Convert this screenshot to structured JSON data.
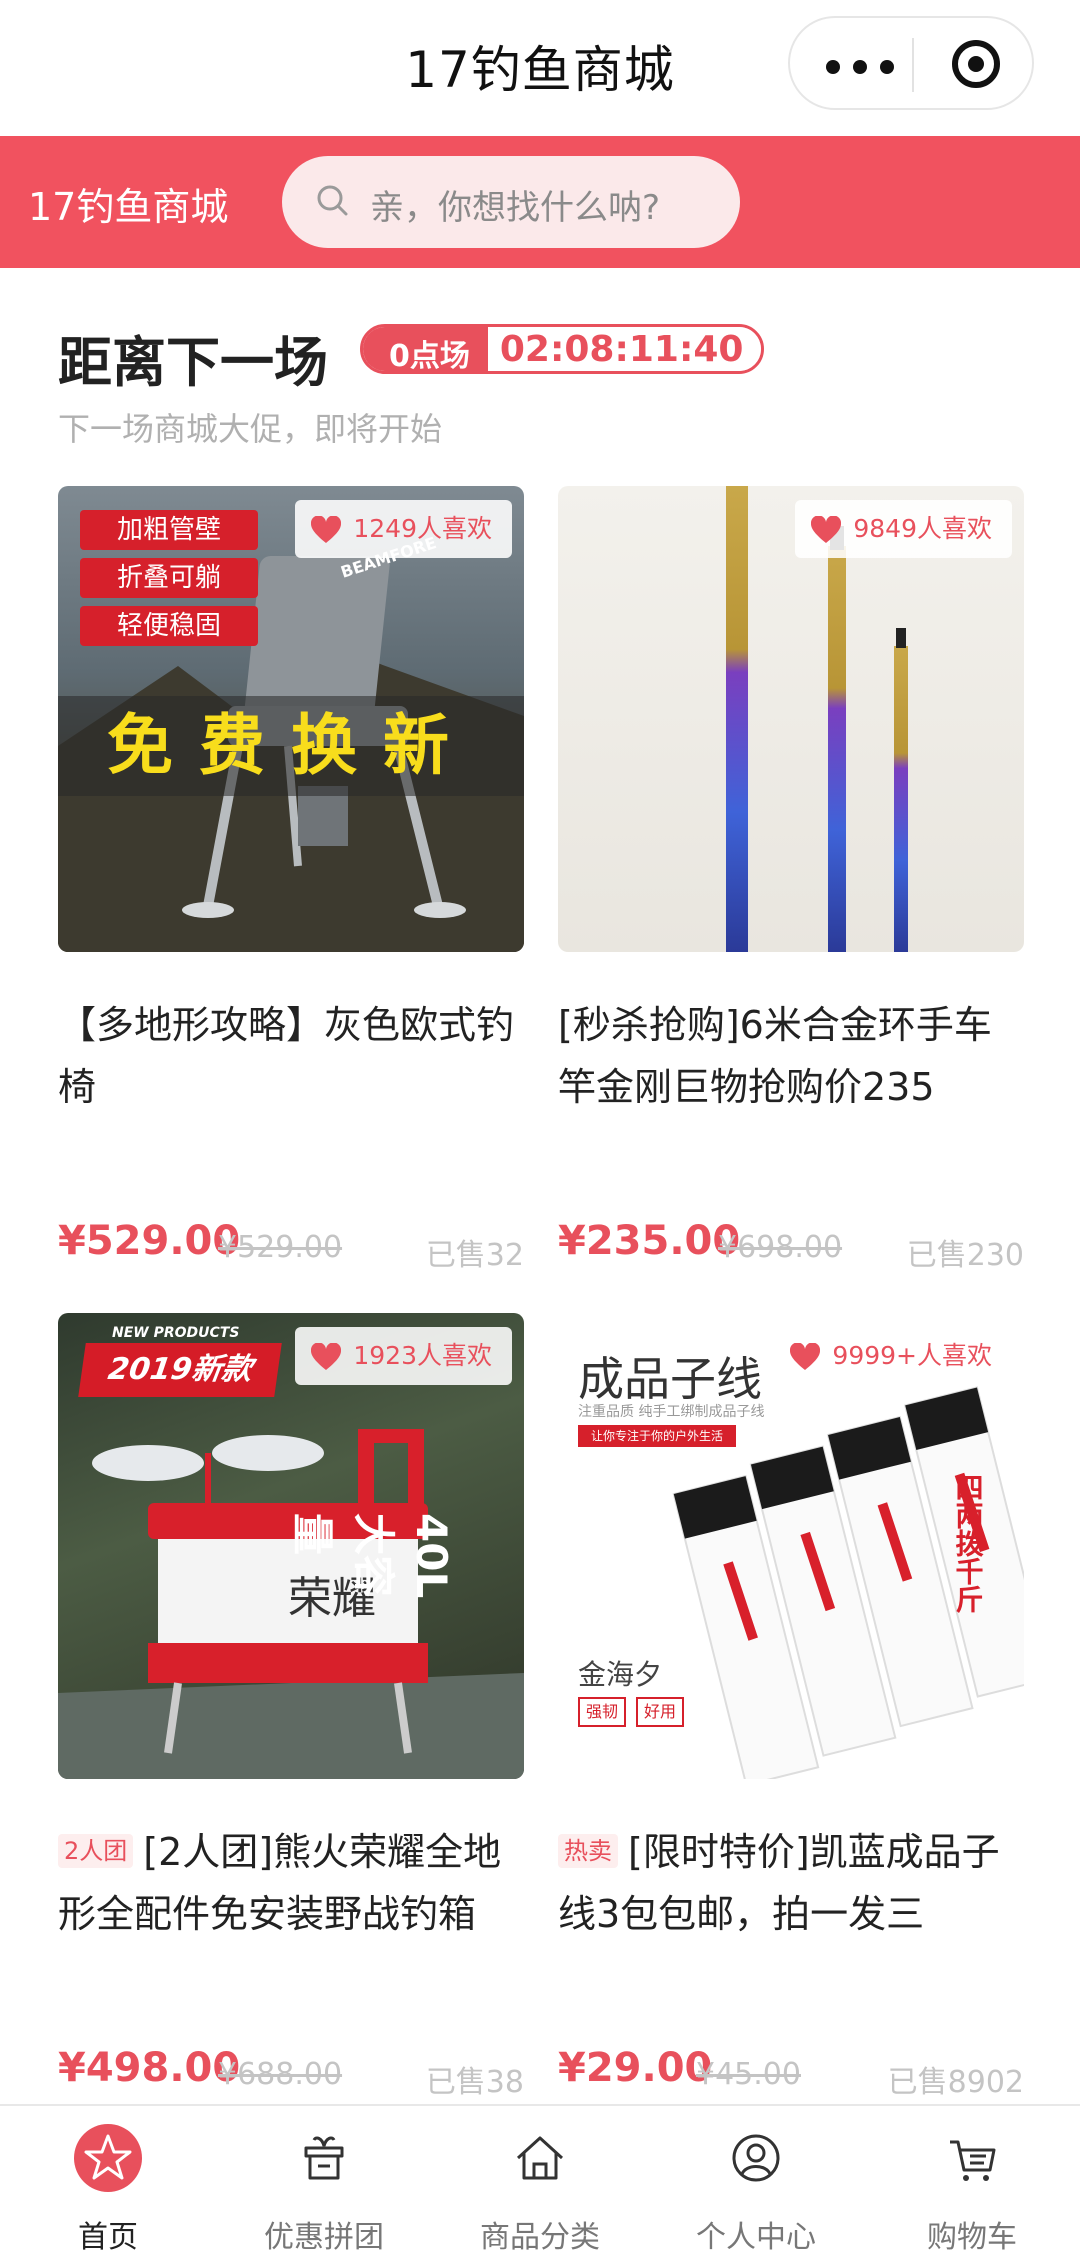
{
  "topbar": {
    "title": "17钓鱼商城"
  },
  "header": {
    "brand": "17钓鱼商城",
    "search_placeholder": "亲，你想找什么呐?"
  },
  "countdown": {
    "title": "距离下一场",
    "session_label": "0点场",
    "time": "02:08:11:40",
    "subtitle": "下一场商城大促，即将开始"
  },
  "products": [
    {
      "likes": "1249人喜欢",
      "title": "【多地形攻略】灰色欧式钓椅",
      "tag": "",
      "price": "¥529.00",
      "original_price": "¥529.00",
      "sold": "已售32",
      "image_text": {
        "tags": [
          "加粗管壁",
          "折叠可躺",
          "轻便稳固"
        ],
        "banner": "免费换新",
        "brand": "BEAMFORE"
      }
    },
    {
      "likes": "9849人喜欢",
      "title": "[秒杀抢购]6米合金环手车竿金刚巨物抢购价235",
      "tag": "",
      "price": "¥235.00",
      "original_price": "¥698.00",
      "sold": "已售230"
    },
    {
      "likes": "1923人喜欢",
      "title": "[2人团]熊火荣耀全地形全配件免安装野战钓箱",
      "tag": "2人团",
      "price": "¥498.00",
      "original_price": "¥688.00",
      "sold": "已售38",
      "image_text": {
        "top": "NEW PRODUCTS",
        "badge": "2019新款",
        "logo": "荣耀",
        "capacity": "40L大容量"
      }
    },
    {
      "likes": "9999+人喜欢",
      "title": "[限时特价]凯蓝成品子线3包包邮，拍一发三",
      "tag": "热卖",
      "price": "¥29.00",
      "original_price": "¥45.00",
      "sold": "已售8902",
      "image_text": {
        "title": "成品子线",
        "sub": "注重品质 纯手工绑制成品子线",
        "red": "让你专注于你的户外生活",
        "brand": "金海夕",
        "chip1": "强韧",
        "chip2": "好用",
        "pack": "四两拨千斤"
      }
    }
  ],
  "tabbar": [
    {
      "label": "首页",
      "icon": "star-icon",
      "active": true
    },
    {
      "label": "优惠拼团",
      "icon": "gift-icon",
      "active": false
    },
    {
      "label": "商品分类",
      "icon": "home-icon",
      "active": false
    },
    {
      "label": "个人中心",
      "icon": "user-icon",
      "active": false
    },
    {
      "label": "购物车",
      "icon": "cart-icon",
      "active": false
    }
  ],
  "colors": {
    "accent": "#f1525f",
    "price": "#e8505c",
    "muted": "#c4c4c4"
  }
}
